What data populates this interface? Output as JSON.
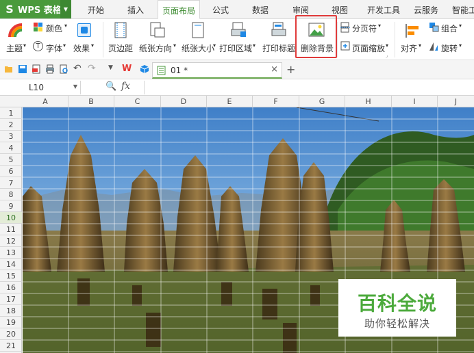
{
  "app": {
    "logo": "S",
    "name": "WPS 表格"
  },
  "menu": {
    "tabs": [
      {
        "label": "开始"
      },
      {
        "label": "插入"
      },
      {
        "label": "页面布局"
      },
      {
        "label": "公式"
      },
      {
        "label": "数据"
      },
      {
        "label": "审阅"
      },
      {
        "label": "视图"
      },
      {
        "label": "开发工具"
      },
      {
        "label": "云服务"
      },
      {
        "label": "智能工"
      }
    ],
    "active_tab": "页面布局"
  },
  "ribbon": {
    "theme_label": "主题",
    "color_label": "颜色",
    "font_label": "字体",
    "effect_label": "效果",
    "margins_label": "页边距",
    "orientation_label": "纸张方向",
    "size_label": "纸张大小",
    "print_area_label": "打印区域",
    "print_titles_label": "打印标题",
    "delete_bg_label": "删除背景",
    "page_break_label": "分页符",
    "page_zoom_label": "页面缩放",
    "align_label": "对齐",
    "group_label": "组合",
    "rotate_label": "旋转",
    "highlight_color": "#e03a3a"
  },
  "doc_tab": {
    "label": "01 *",
    "close": "×",
    "add": "+"
  },
  "formula_bar": {
    "cell_ref": "L10",
    "fx": "fx",
    "value": ""
  },
  "grid": {
    "columns": [
      "A",
      "B",
      "C",
      "D",
      "E",
      "F",
      "G",
      "H",
      "I",
      "J"
    ],
    "rows": [
      "1",
      "2",
      "3",
      "4",
      "5",
      "6",
      "7",
      "8",
      "9",
      "10",
      "11",
      "12",
      "13",
      "14",
      "15",
      "16",
      "17",
      "18",
      "19",
      "20",
      "21"
    ],
    "active_row": "10",
    "background_image": "rice-straw-field-photo"
  },
  "watermark": {
    "title": "百科全说",
    "subtitle": "助你轻松解决"
  },
  "colors": {
    "brand_green": "#4a9a3c",
    "active_tab_text": "#3b8a2f",
    "watermark_green": "#4caa3c"
  }
}
